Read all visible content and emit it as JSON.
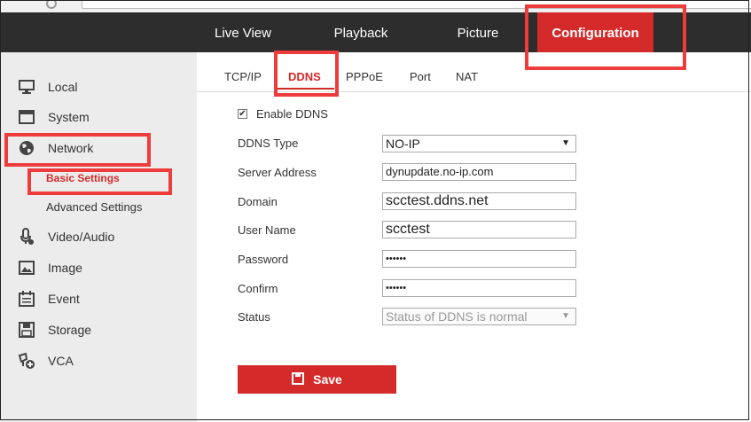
{
  "topnav": {
    "tabs": [
      {
        "label": "Live View"
      },
      {
        "label": "Playback"
      },
      {
        "label": "Picture"
      },
      {
        "label": "Configuration",
        "active": true
      }
    ]
  },
  "sidebar": {
    "items": [
      {
        "label": "Local",
        "icon": "monitor-icon"
      },
      {
        "label": "System",
        "icon": "window-icon"
      },
      {
        "label": "Network",
        "icon": "globe-icon"
      },
      {
        "label": "Video/Audio",
        "icon": "microphone-icon"
      },
      {
        "label": "Image",
        "icon": "image-icon"
      },
      {
        "label": "Event",
        "icon": "calendar-icon"
      },
      {
        "label": "Storage",
        "icon": "floppy-icon"
      },
      {
        "label": "VCA",
        "icon": "vca-icon"
      }
    ],
    "network_sub": [
      {
        "label": "Basic Settings",
        "active": true
      },
      {
        "label": "Advanced Settings"
      }
    ]
  },
  "subtabs": [
    {
      "label": "TCP/IP"
    },
    {
      "label": "DDNS",
      "active": true
    },
    {
      "label": "PPPoE"
    },
    {
      "label": "Port"
    },
    {
      "label": "NAT"
    }
  ],
  "form": {
    "enable_label": "Enable DDNS",
    "enable_checked": true,
    "ddns_type": {
      "label": "DDNS Type",
      "value": "NO-IP"
    },
    "server_address": {
      "label": "Server Address",
      "value": "dynupdate.no-ip.com"
    },
    "domain": {
      "label": "Domain",
      "value": "scctest.ddns.net"
    },
    "user_name": {
      "label": "User Name",
      "value": "scctest"
    },
    "password": {
      "label": "Password",
      "value": "••••••"
    },
    "confirm": {
      "label": "Confirm",
      "value": "••••••"
    },
    "status": {
      "label": "Status",
      "value": "Status of DDNS is normal"
    }
  },
  "save_label": "Save",
  "colors": {
    "accent": "#d42a2a",
    "nav_bg": "#2d2d2d",
    "sidebar_bg": "#ececec",
    "highlight": "#ee3b3b"
  }
}
